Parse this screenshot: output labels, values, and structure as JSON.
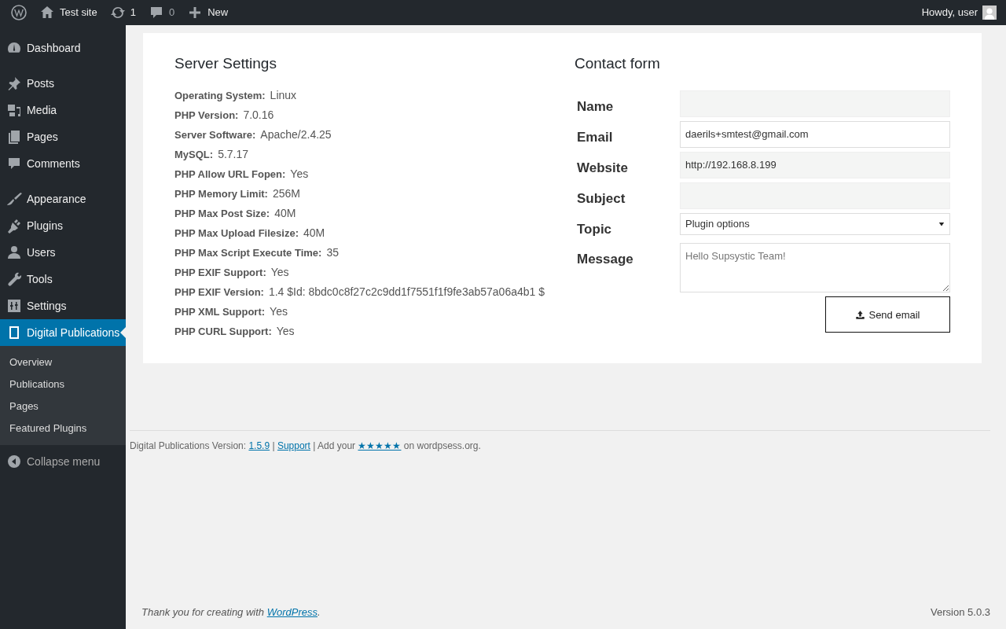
{
  "admin_bar": {
    "site": "Test site",
    "updates": "1",
    "comments": "0",
    "new": "New",
    "greeting": "Howdy, user"
  },
  "menu_groups": [
    {
      "items": [
        {
          "label": "Dashboard",
          "selected": false
        }
      ]
    },
    {
      "items": [
        {
          "label": "Posts",
          "selected": false
        },
        {
          "label": "Media",
          "selected": false
        },
        {
          "label": "Pages",
          "selected": false
        },
        {
          "label": "Comments",
          "selected": false
        }
      ]
    },
    {
      "items": [
        {
          "label": "Appearance",
          "selected": false
        },
        {
          "label": "Plugins",
          "selected": false
        },
        {
          "label": "Users",
          "selected": false
        },
        {
          "label": "Tools",
          "selected": false
        },
        {
          "label": "Settings",
          "selected": false
        },
        {
          "label": "Digital Publications",
          "selected": true,
          "children": [
            {
              "label": "Overview"
            },
            {
              "label": "Publications"
            },
            {
              "label": "Pages"
            },
            {
              "label": "Featured Plugins"
            }
          ]
        }
      ]
    }
  ],
  "collapse_menu": "Collapse menu",
  "server_settings": {
    "title": "Server Settings",
    "rows": [
      {
        "label": "Operating System:",
        "value": "Linux"
      },
      {
        "label": "PHP Version:",
        "value": "7.0.16"
      },
      {
        "label": "Server Software:",
        "value": "Apache/2.4.25"
      },
      {
        "label": "MySQL:",
        "value": "5.7.17"
      },
      {
        "label": "PHP Allow URL Fopen:",
        "value": "Yes"
      },
      {
        "label": "PHP Memory Limit:",
        "value": "256M"
      },
      {
        "label": "PHP Max Post Size:",
        "value": "40M"
      },
      {
        "label": "PHP Max Upload Filesize:",
        "value": "40M"
      },
      {
        "label": "PHP Max Script Execute Time:",
        "value": "35"
      },
      {
        "label": "PHP EXIF Support:",
        "value": "Yes"
      },
      {
        "label": "PHP EXIF Version:",
        "value": "1.4 $Id: 8bdc0c8f27c2c9dd1f7551f1f9fe3ab57a06a4b1 $"
      },
      {
        "label": "PHP XML Support:",
        "value": "Yes"
      },
      {
        "label": "PHP CURL Support:",
        "value": "Yes"
      }
    ]
  },
  "contact_form": {
    "title": "Contact form",
    "fields": [
      {
        "label": "Name",
        "kind": "text",
        "readonly": true
      },
      {
        "label": "Email",
        "kind": "text",
        "readonly": false,
        "value": "daerils+smtest@gmail.com"
      },
      {
        "label": "Website",
        "kind": "text",
        "readonly": true,
        "value": "http://192.168.8.199"
      },
      {
        "label": "Subject",
        "kind": "text",
        "readonly": true
      },
      {
        "label": "Topic",
        "kind": "select",
        "value": "Plugin options"
      },
      {
        "label": "Message",
        "kind": "textarea",
        "placeholder": "Hello Supsystic Team!"
      }
    ],
    "submit": "Send email"
  },
  "plugin_footer": [
    {
      "kind": "text",
      "text": "Digital Publications Version: "
    },
    {
      "kind": "link",
      "text": "1.5.9"
    },
    {
      "kind": "text",
      "text": " | "
    },
    {
      "kind": "link",
      "text": "Support"
    },
    {
      "kind": "text",
      "text": " | Add your "
    },
    {
      "kind": "link",
      "text": "★★★★★"
    },
    {
      "kind": "text",
      "text": " on wordpsess.org."
    }
  ],
  "wp_footer": {
    "thanks": [
      {
        "kind": "text",
        "text": "Thank you for creating with "
      },
      {
        "kind": "link",
        "text": "WordPress"
      },
      {
        "kind": "text",
        "text": "."
      }
    ],
    "version": "Version 5.0.3"
  }
}
